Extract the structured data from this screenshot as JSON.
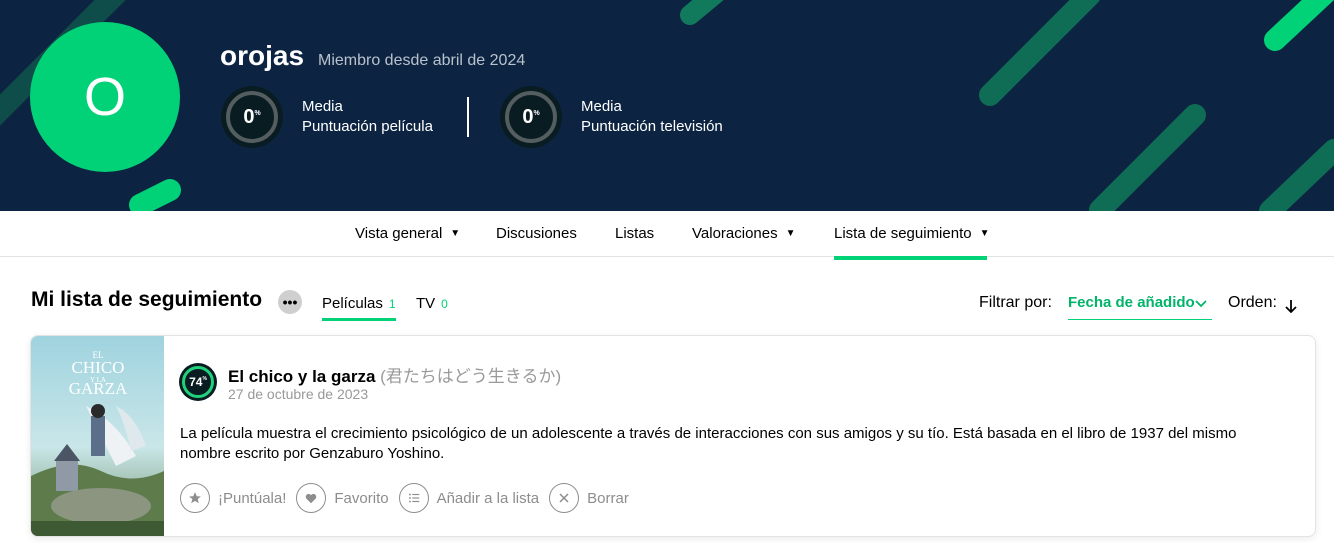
{
  "profile": {
    "avatar_letter": "O",
    "username": "orojas",
    "member_since": "Miembro desde abril de 2024",
    "movie_score": {
      "value": "0",
      "unit": "%",
      "line1": "Media",
      "line2": "Puntuación película"
    },
    "tv_score": {
      "value": "0",
      "unit": "%",
      "line1": "Media",
      "line2": "Puntuación televisión"
    }
  },
  "nav": {
    "items": [
      {
        "label": "Vista general",
        "caret": "▼"
      },
      {
        "label": "Discusiones"
      },
      {
        "label": "Listas"
      },
      {
        "label": "Valoraciones",
        "caret": "▼"
      },
      {
        "label": "Lista de seguimiento",
        "caret": "▼",
        "active": true
      }
    ]
  },
  "watchlist": {
    "title": "Mi lista de seguimiento",
    "more_label": "•••",
    "tabs": [
      {
        "label": "Películas",
        "count": "1",
        "active": true
      },
      {
        "label": "TV",
        "count": "0"
      }
    ],
    "filter_label": "Filtrar por:",
    "filter_value": "Fecha de añadido",
    "order_label": "Orden:"
  },
  "items": [
    {
      "score": "74",
      "score_unit": "%",
      "title": "El chico y la garza",
      "original_title": "(君たちはどう生きるか)",
      "date": "27 de octubre de 2023",
      "overview": "La película muestra el crecimiento psicológico de un adolescente a través de interacciones con sus amigos y su tío. Está basada en el libro de 1937 del mismo nombre escrito por Genzaburo Yoshino.",
      "poster_text": {
        "line1": "EL",
        "line2": "CHICO",
        "line3": "Y LA",
        "line4": "GARZA"
      },
      "actions": {
        "rate": "¡Puntúala!",
        "favorite": "Favorito",
        "add_list": "Añadir a la lista",
        "remove": "Borrar"
      }
    }
  ],
  "colors": {
    "header_bg": "#0c2442",
    "accent_green": "#01d277",
    "score_ring_high": "#21d07a"
  }
}
